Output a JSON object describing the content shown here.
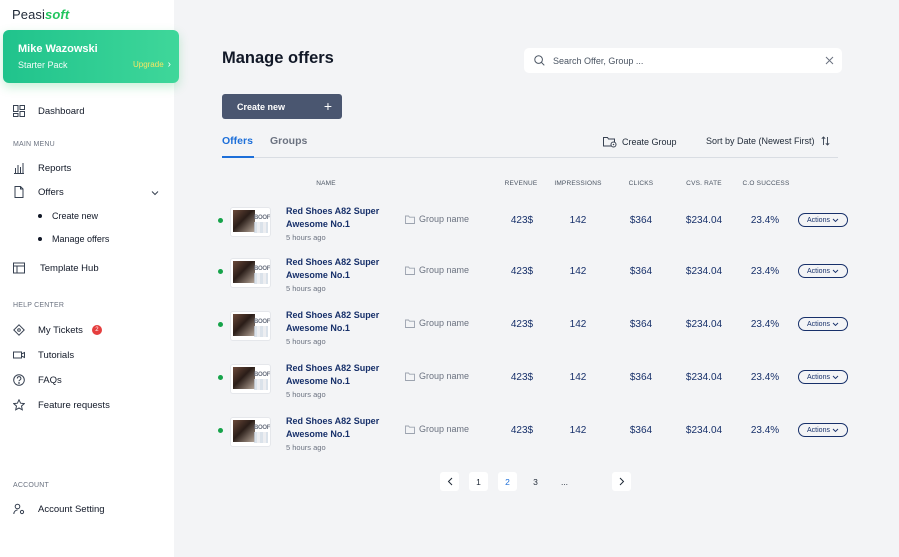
{
  "brand": {
    "prefix": "Peasi",
    "suffix": "soft"
  },
  "user": {
    "name": "Mike Wazowski",
    "plan": "Starter Pack",
    "upgrade_label": "Upgrade"
  },
  "sidebar": {
    "dashboard": "Dashboard",
    "main_menu_label": "MAIN MENU",
    "reports": "Reports",
    "offers": "Offers",
    "offers_sub": [
      "Create new",
      "Manage offers"
    ],
    "template_hub": "Template Hub",
    "help_center_label": "HELP CENTER",
    "my_tickets": "My Tickets",
    "tickets_count": "2",
    "tutorials": "Tutorials",
    "faqs": "FAQs",
    "feature_requests": "Feature requests",
    "account_label": "ACCOUNT",
    "account_setting": "Account Setting"
  },
  "main": {
    "title": "Manage offers",
    "search_placeholder": "Search Offer, Group ...",
    "create_label": "Create new",
    "tabs": [
      "Offers",
      "Groups"
    ],
    "create_group": "Create Group",
    "sort_label": "Sort by Date (Newest First)"
  },
  "table": {
    "headers": [
      "NAME",
      "REVENUE",
      "IMPRESSIONS",
      "CLICKS",
      "CVS. RATE",
      "C.O SUCCESS"
    ],
    "thumb_text": "BOOF",
    "rows": [
      {
        "name": "Red Shoes A82 Super Awesome No.1",
        "ago": "5 hours ago",
        "group": "Group name",
        "revenue": "423$",
        "impressions": "142",
        "clicks": "$364",
        "cvs": "$234.04",
        "co": "23.4%",
        "actions": "Actions"
      },
      {
        "name": "Red Shoes A82 Super Awesome No.1",
        "ago": "5 hours ago",
        "group": "Group name",
        "revenue": "423$",
        "impressions": "142",
        "clicks": "$364",
        "cvs": "$234.04",
        "co": "23.4%",
        "actions": "Actions"
      },
      {
        "name": "Red Shoes A82 Super Awesome No.1",
        "ago": "5 hours ago",
        "group": "Group name",
        "revenue": "423$",
        "impressions": "142",
        "clicks": "$364",
        "cvs": "$234.04",
        "co": "23.4%",
        "actions": "Actions"
      },
      {
        "name": "Red Shoes A82 Super Awesome No.1",
        "ago": "5 hours ago",
        "group": "Group name",
        "revenue": "423$",
        "impressions": "142",
        "clicks": "$364",
        "cvs": "$234.04",
        "co": "23.4%",
        "actions": "Actions"
      },
      {
        "name": "Red Shoes A82 Super Awesome No.1",
        "ago": "5 hours ago",
        "group": "Group name",
        "revenue": "423$",
        "impressions": "142",
        "clicks": "$364",
        "cvs": "$234.04",
        "co": "23.4%",
        "actions": "Actions"
      }
    ]
  },
  "pagination": {
    "pages": [
      "1",
      "2",
      "3",
      "..."
    ],
    "current": "2"
  }
}
